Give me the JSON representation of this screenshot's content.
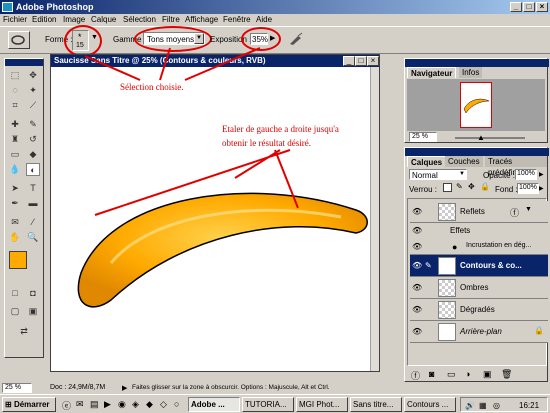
{
  "app_title": "Adobe Photoshop",
  "window_controls": {
    "minimize": "_",
    "maximize": "□",
    "close": "×"
  },
  "menu": [
    "Fichier",
    "Edition",
    "Image",
    "Calque",
    "Sélection",
    "Filtre",
    "Affichage",
    "Fenêtre",
    "Aide"
  ],
  "options": {
    "forme_label": "Forme :",
    "brush_size": "15",
    "gamme_label": "Gamme :",
    "gamme_value": "Tons moyens",
    "exposition_label": "Exposition :",
    "exposition_value": "35%"
  },
  "document": {
    "title": "Saucisse Sans Titre @ 25% (Contours & couleurs, RVB)"
  },
  "annotations": {
    "selection": "Sélection choisie.",
    "instruction_line1": "Etaler de gauche a droite jusqu'a",
    "instruction_line2": "obtenir le résultat désiré."
  },
  "navigator": {
    "tab": "Navigateur",
    "tab2": "Infos",
    "zoom": "25 %"
  },
  "layers_panel": {
    "tab": "Calques",
    "tab2": "Couches",
    "tab3": "Tracés prédéfinis",
    "mode": "Normal",
    "opacity_label": "Opacité :",
    "opacity_value": "100%",
    "lock_label": "Verrou :",
    "fill_label": "Fond :",
    "fill_value": "100%",
    "layers": [
      {
        "name": "Reflets"
      },
      {
        "name": "Effets"
      },
      {
        "name": "Incrustation en dég..."
      },
      {
        "name": "Contours & co..."
      },
      {
        "name": "Ombres"
      },
      {
        "name": "Dégradés"
      },
      {
        "name": "Arrière-plan"
      }
    ]
  },
  "statusbar": {
    "zoom": "25 %",
    "doc": "Doc : 24,9M/8,7M",
    "hint": "Faites glisser sur la zone à obscurcir. Options : Majuscule, Alt et Ctrl."
  },
  "taskbar": {
    "start": "Démarrer",
    "tasks": [
      "Adobe ...",
      "TUTORIA...",
      "MGI Phot...",
      "Sans titre...",
      "Contours ..."
    ],
    "clock": "16:21"
  },
  "colors": {
    "titlebar": "#0a246a",
    "annotation": "#e00000",
    "shape_orange": "#ffaa00"
  }
}
